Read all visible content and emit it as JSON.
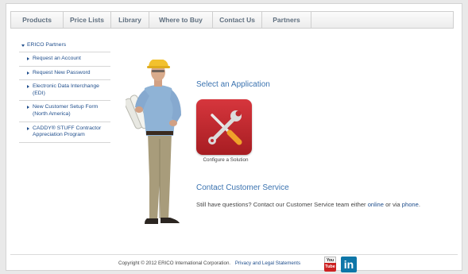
{
  "nav": {
    "items": [
      "Products",
      "Price Lists",
      "Library",
      "Where to Buy",
      "Contact Us",
      "Partners"
    ]
  },
  "sidebar": {
    "heading": "ERICO Partners",
    "items": [
      [
        "Request an Account"
      ],
      [
        "Request New Password"
      ],
      [
        "Electronic Data Interchange",
        "(EDI)"
      ],
      [
        "New Customer Setup Form",
        "(North America)"
      ],
      [
        "CADDY® STUFF Contractor",
        "Appreciation Program"
      ]
    ]
  },
  "main": {
    "select_heading": "Select an Application",
    "app_caption": "Configure a Solution",
    "contact_heading": "Contact Customer Service",
    "contact_text_1": "Still have questions? Contact our Customer Service team either ",
    "contact_link_online": "online",
    "contact_text_2": " or via ",
    "contact_link_phone": "phone",
    "contact_text_3": "."
  },
  "footer": {
    "copyright": "Copyright © 2012 ERICO International Corporation.",
    "privacy_link": "Privacy and Legal Statements",
    "youtube_you": "You",
    "youtube_tube": "Tube",
    "linkedin": "in"
  },
  "colors": {
    "link": "#1f4e8c",
    "heading": "#3b73b0",
    "app_tile": "#c0282e"
  }
}
